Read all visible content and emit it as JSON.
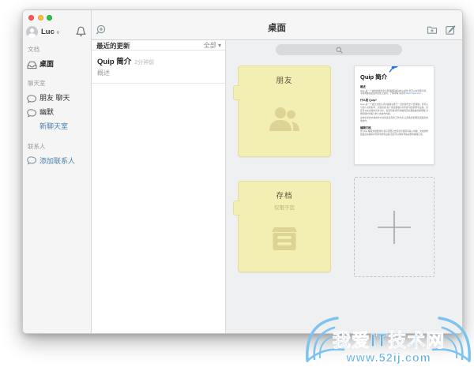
{
  "accent_colors": {
    "folder_yellow": "#f3eeb2",
    "link_blue": "#4a7fae",
    "pin_blue": "#2d74d8",
    "watermark_blue": "#5fb0e8",
    "main_bg": "#eff0f2"
  },
  "titlebar": {
    "user_name": "Luc",
    "user_caret": "∨"
  },
  "sidebar": {
    "section_documents": "文档",
    "item_desktop": "桌面",
    "section_chats": "聊天室",
    "item_friends_chat": "朋友 聊天",
    "item_humor": "幽默",
    "link_new_chat": "新聊天室",
    "section_contacts": "联系人",
    "link_add_contact": "添加联系人"
  },
  "toolbar": {
    "title": "桌面"
  },
  "updates_panel": {
    "header": "最近的更新",
    "filter_label": "全部",
    "filter_caret": "▾",
    "items": [
      {
        "title": "Quip 简介",
        "time": "2分钟前",
        "subtitle": "概述"
      }
    ]
  },
  "main": {
    "search_value": "",
    "folders": [
      {
        "name": "朋友",
        "subtitle": "",
        "glyph": "people-icon"
      },
      {
        "name": "存档",
        "subtitle": "仅限于您",
        "glyph": "archive-icon"
      }
    ],
    "doc_card": {
      "title": "Quip 简介",
      "overview_heading": "概述",
      "overview_text": "Quip 是一个协作的现代文字处理器和移动办公套件,您可以在智能手机、平板电脑和桌面浏览器上使用。了解详情,请访问:",
      "overview_link": "https://quip.com 。",
      "what_heading": "什么是 Quip?",
      "what_text_1": "Quip 是一个集合文档与消息编辑功能于一身的现代文字处理器。您可以与他人共同起草、创建文档,每个修改都会实时同步到您的所有设备。您还可以在文档中实时讨论、提及同事,所有的编辑历史都会被完整保留,方便您随时查看与他人的协作内容。",
      "what_text_2": "这种全新的文档协作方式将改变您的工作方式,让您和您的团队更加高效地协作。",
      "edit_heading": "编辑文档",
      "edit_text": "用 Quip 编辑文档很简单,您只需要点击任意位置即可输入内容。文档的修改会自动保存并同步到所有设备,您还可以随时查看完整的编辑记录。"
    },
    "new_document_plus": "+"
  },
  "watermark": {
    "line1": "我爱IT技术网",
    "line2": "www.52ij.com"
  }
}
